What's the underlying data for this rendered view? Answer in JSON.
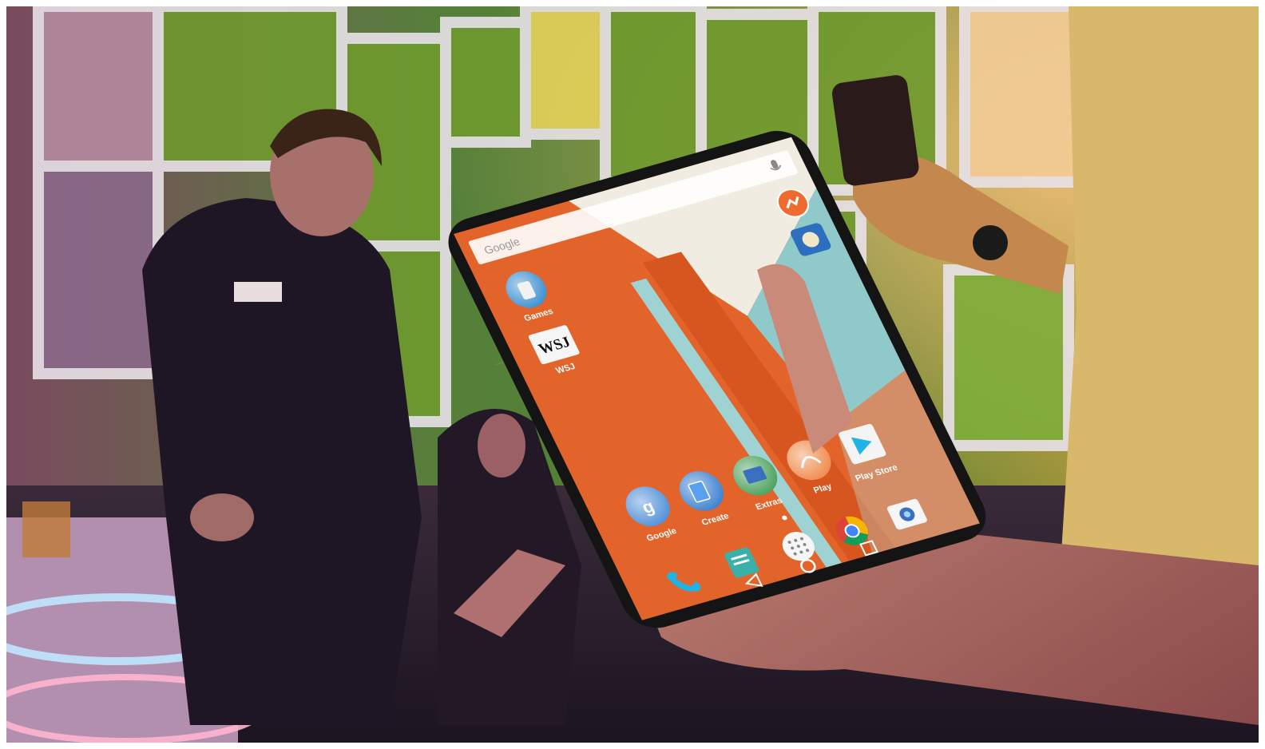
{
  "scene": {
    "colors": {
      "wall_green": "#6f9a2e",
      "screen_orange": "#e2642a",
      "screen_teal": "#8fc9c9",
      "screen_cream": "#f1ece2",
      "phone_body": "#141414"
    }
  },
  "phone": {
    "search": {
      "placeholder": "Google",
      "icon": "mic-icon"
    },
    "apps": [
      {
        "label": "Games",
        "icon": "games-folder-icon"
      },
      {
        "label": "WSJ",
        "icon": "wsj-app-icon",
        "icon_text": "WSJ"
      },
      {
        "label": "Google",
        "icon": "google-folder-icon"
      },
      {
        "label": "Create",
        "icon": "create-folder-icon"
      },
      {
        "label": "Extras",
        "icon": "extras-folder-icon"
      },
      {
        "label": "Play",
        "icon": "play-folder-icon"
      },
      {
        "label": "Play Store",
        "icon": "play-store-icon"
      }
    ],
    "dock": [
      "phone-icon",
      "messenger-icon",
      "app-drawer-icon",
      "chrome-icon",
      "camera-icon"
    ],
    "nav": [
      "back-icon",
      "home-icon",
      "recents-icon"
    ]
  }
}
